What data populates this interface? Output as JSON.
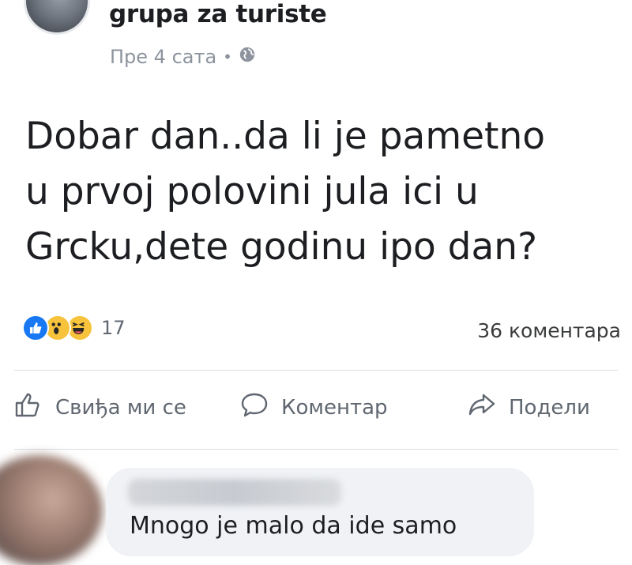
{
  "post": {
    "group_name": "grupa za turiste",
    "time": "Пре 4 сата",
    "separator": "•",
    "privacy_icon": "globe-icon",
    "text": "Dobar dan..da li je pametno\nu prvoj polovini jula ici u\nGrcku,dete godinu ipo dan?"
  },
  "stats": {
    "reaction_icons": [
      "like-reaction-icon",
      "wow-reaction-icon",
      "haha-reaction-icon"
    ],
    "reaction_count": "17",
    "comments_count": "36 коментара"
  },
  "actions": {
    "like_label": "Свиђа ми се",
    "comment_label": "Коментар",
    "share_label": "Подели"
  },
  "comment": {
    "text": "Mnogo je malo da ide samo"
  },
  "colors": {
    "like_blue": "#1877f2",
    "reaction_yellow": "#f7c33c",
    "meta_gray": "#8d949e",
    "bubble_bg": "#f0f2f5"
  }
}
